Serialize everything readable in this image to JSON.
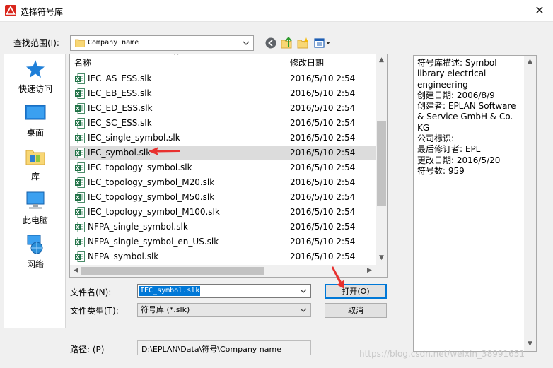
{
  "window": {
    "title": "选择符号库",
    "close_glyph": "✕"
  },
  "lookin": {
    "label": "查找范围(I):",
    "value": "Company name"
  },
  "toolbar": [
    "back-icon",
    "up-folder-icon",
    "new-folder-icon",
    "view-menu-icon"
  ],
  "places": [
    {
      "label": "快速访问",
      "icon": "star-icon"
    },
    {
      "label": "桌面",
      "icon": "desktop-icon"
    },
    {
      "label": "库",
      "icon": "library-icon"
    },
    {
      "label": "此电脑",
      "icon": "computer-icon"
    },
    {
      "label": "网络",
      "icon": "network-icon"
    }
  ],
  "filelist": {
    "columns": {
      "name": "名称",
      "date": "修改日期"
    },
    "sort_glyph": "^",
    "files": [
      {
        "name": "IEC_AS_ESS.slk",
        "date": "2016/5/10 2:54"
      },
      {
        "name": "IEC_EB_ESS.slk",
        "date": "2016/5/10 2:54"
      },
      {
        "name": "IEC_ED_ESS.slk",
        "date": "2016/5/10 2:54"
      },
      {
        "name": "IEC_SC_ESS.slk",
        "date": "2016/5/10 2:54"
      },
      {
        "name": "IEC_single_symbol.slk",
        "date": "2016/5/10 2:54"
      },
      {
        "name": "IEC_symbol.slk",
        "date": "2016/5/10 2:54",
        "selected": true
      },
      {
        "name": "IEC_topology_symbol.slk",
        "date": "2016/5/10 2:54"
      },
      {
        "name": "IEC_topology_symbol_M20.slk",
        "date": "2016/5/10 2:54"
      },
      {
        "name": "IEC_topology_symbol_M50.slk",
        "date": "2016/5/10 2:54"
      },
      {
        "name": "IEC_topology_symbol_M100.slk",
        "date": "2016/5/10 2:54"
      },
      {
        "name": "NFPA_single_symbol.slk",
        "date": "2016/5/10 2:54"
      },
      {
        "name": "NFPA_single_symbol_en_US.slk",
        "date": "2016/5/10 2:54"
      },
      {
        "name": "NFPA_symbol.slk",
        "date": "2016/5/10 2:54"
      }
    ]
  },
  "description": {
    "lines": [
      "符号库描述: Symbol library electrical engineering",
      "创建日期: 2006/8/9",
      "创建者: EPLAN Software & Service GmbH & Co. KG",
      "公司标识:",
      "最后修订者: EPL",
      "更改日期: 2016/5/20",
      "符号数: 959"
    ]
  },
  "form": {
    "filename_label": "文件名(N):",
    "filename_value": "IEC_symbol.slk",
    "filetype_label": "文件类型(T):",
    "filetype_value": "符号库 (*.slk)",
    "open_label": "打开(O)",
    "cancel_label": "取消",
    "path_label": "路径: (P)",
    "path_value": "D:\\EPLAN\\Data\\符号\\Company name"
  },
  "watermark": "https://blog.csdn.net/weixin_38991651",
  "colors": {
    "selection": "#0078d7",
    "annotation_arrow": "#e8312f",
    "excel_green": "#1e7145"
  }
}
